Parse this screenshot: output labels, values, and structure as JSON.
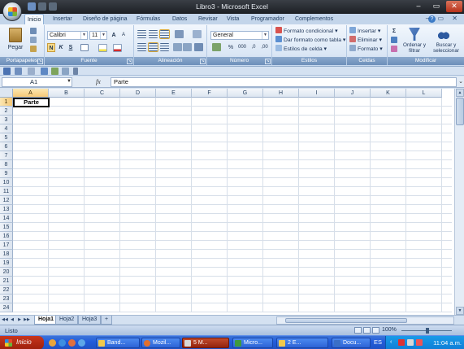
{
  "window": {
    "title": "Libro3 - Microsoft Excel",
    "minimize": "–",
    "restore": "▭",
    "close": "✕"
  },
  "tabs": [
    "Inicio",
    "Insertar",
    "Diseño de página",
    "Fórmulas",
    "Datos",
    "Revisar",
    "Vista",
    "Programador",
    "Complementos"
  ],
  "tab_controls": "– ▭ ✕",
  "ribbon": {
    "portapapeles": {
      "label": "Portapapeles",
      "paste": "Pegar"
    },
    "fuente": {
      "label": "Fuente",
      "font": "Calibri",
      "size": "11",
      "grow": "A",
      "shrink": "A",
      "bold": "N",
      "italic": "K",
      "underline": "S"
    },
    "alineacion": {
      "label": "Alineación"
    },
    "numero": {
      "label": "Número",
      "format": "General",
      "percent": "%",
      "thousands": "000",
      "inc_dec": ",0",
      "dec_dec": ",00"
    },
    "estilos": {
      "label": "Estilos",
      "conditional": "Formato condicional",
      "as_table": "Dar formato como tabla",
      "cell_styles": "Estilos de celda"
    },
    "celdas": {
      "label": "Celdas",
      "insert": "Insertar",
      "delete": "Eliminar",
      "format": "Formato"
    },
    "modificar": {
      "label": "Modificar",
      "sigma": "Σ",
      "sort": "Ordenar y filtrar",
      "find": "Buscar y seleccionar"
    }
  },
  "formula_bar": {
    "name_box": "A1",
    "fx": "fx",
    "content": "Parte"
  },
  "columns": [
    "A",
    "B",
    "C",
    "D",
    "E",
    "F",
    "G",
    "H",
    "I",
    "J",
    "K",
    "L"
  ],
  "rows": [
    "1",
    "2",
    "3",
    "4",
    "5",
    "6",
    "7",
    "8",
    "9",
    "10",
    "11",
    "12",
    "13",
    "14",
    "15",
    "16",
    "17",
    "18",
    "19",
    "20",
    "21",
    "22",
    "23",
    "24"
  ],
  "active_cell": {
    "ref": "A1",
    "value": "Parte"
  },
  "sheets": [
    "Hoja1",
    "Hoja2",
    "Hoja3"
  ],
  "status": {
    "ready": "Listo",
    "zoom": "100%"
  },
  "taskbar": {
    "start": "Inicio",
    "tasks": [
      "Band...",
      "Mozil...",
      "5 M...",
      "Micro...",
      "2 E...",
      "Docu..."
    ],
    "lang": "ES",
    "clock": "11:04 a.m."
  }
}
